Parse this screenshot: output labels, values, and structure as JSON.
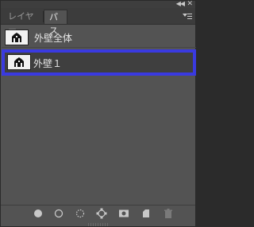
{
  "tabs": [
    {
      "label": "レイヤー",
      "active": false
    },
    {
      "label": "パス",
      "active": true
    }
  ],
  "icons": {
    "collapse": "double-chevron-left-icon",
    "close": "close-icon",
    "menu": "panel-menu-icon",
    "path_thumbnail": "path-shape-thumbnail-icon"
  },
  "paths": [
    {
      "name": "外壁全体",
      "selected": false
    },
    {
      "name": "外壁１",
      "selected": true
    }
  ],
  "bottom_toolbar": [
    "fill-path-icon",
    "stroke-path-icon",
    "load-selection-icon",
    "make-work-path-icon",
    "add-mask-icon",
    "new-path-icon",
    "delete-path-icon"
  ],
  "colors": {
    "panel_bg": "#535353",
    "selection_highlight": "#3a3ae0",
    "text": "#e6e6e6"
  }
}
